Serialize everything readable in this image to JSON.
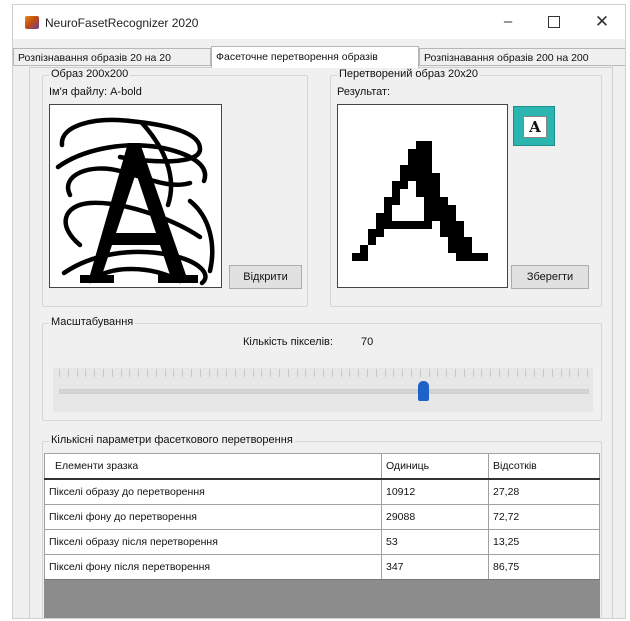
{
  "window": {
    "title": "NeuroFasetRecognizer 2020",
    "minimize_glyph": "–",
    "close_glyph": "✕"
  },
  "tabs": [
    {
      "label": "Розпізнавання образів 20 на 20",
      "active": false
    },
    {
      "label": "Фасеточне перетворення образів",
      "active": true
    },
    {
      "label": "Розпізнавання образів 200 на 200",
      "active": false
    }
  ],
  "source_group": {
    "title": "Образ 200х200",
    "file_label": "Ім'я файлу: A-bold",
    "open_button": "Відкрити"
  },
  "result_group": {
    "title": "Перетворений образ  20х20",
    "result_label": "Результат:",
    "save_button": "Зберегти",
    "preview_letter": "A"
  },
  "scale_group": {
    "title": "Масштабування",
    "pixel_count_label": "Кількість пікселів:",
    "pixel_count_value": "70",
    "slider_fraction": 0.69
  },
  "params_group": {
    "title": "Кількісні параметри фасеткового перетворення",
    "columns": [
      "Елементи зразка",
      "Одиниць",
      "Відсотків"
    ],
    "rows": [
      {
        "name": "Пікселі образу до перетворення",
        "units": "10912",
        "percent": "27,28"
      },
      {
        "name": "Пікселі фону до перетворення",
        "units": "29088",
        "percent": "72,72"
      },
      {
        "name": "Пікселі образу після перетворення",
        "units": "53",
        "percent": "13,25"
      },
      {
        "name": "Пікселі фону після перетворення",
        "units": "347",
        "percent": "86,75"
      }
    ]
  },
  "colors": {
    "accent": "#1e63c7",
    "preview_bg": "#2bb5b0",
    "grid_fill": "#8c8c8c"
  }
}
